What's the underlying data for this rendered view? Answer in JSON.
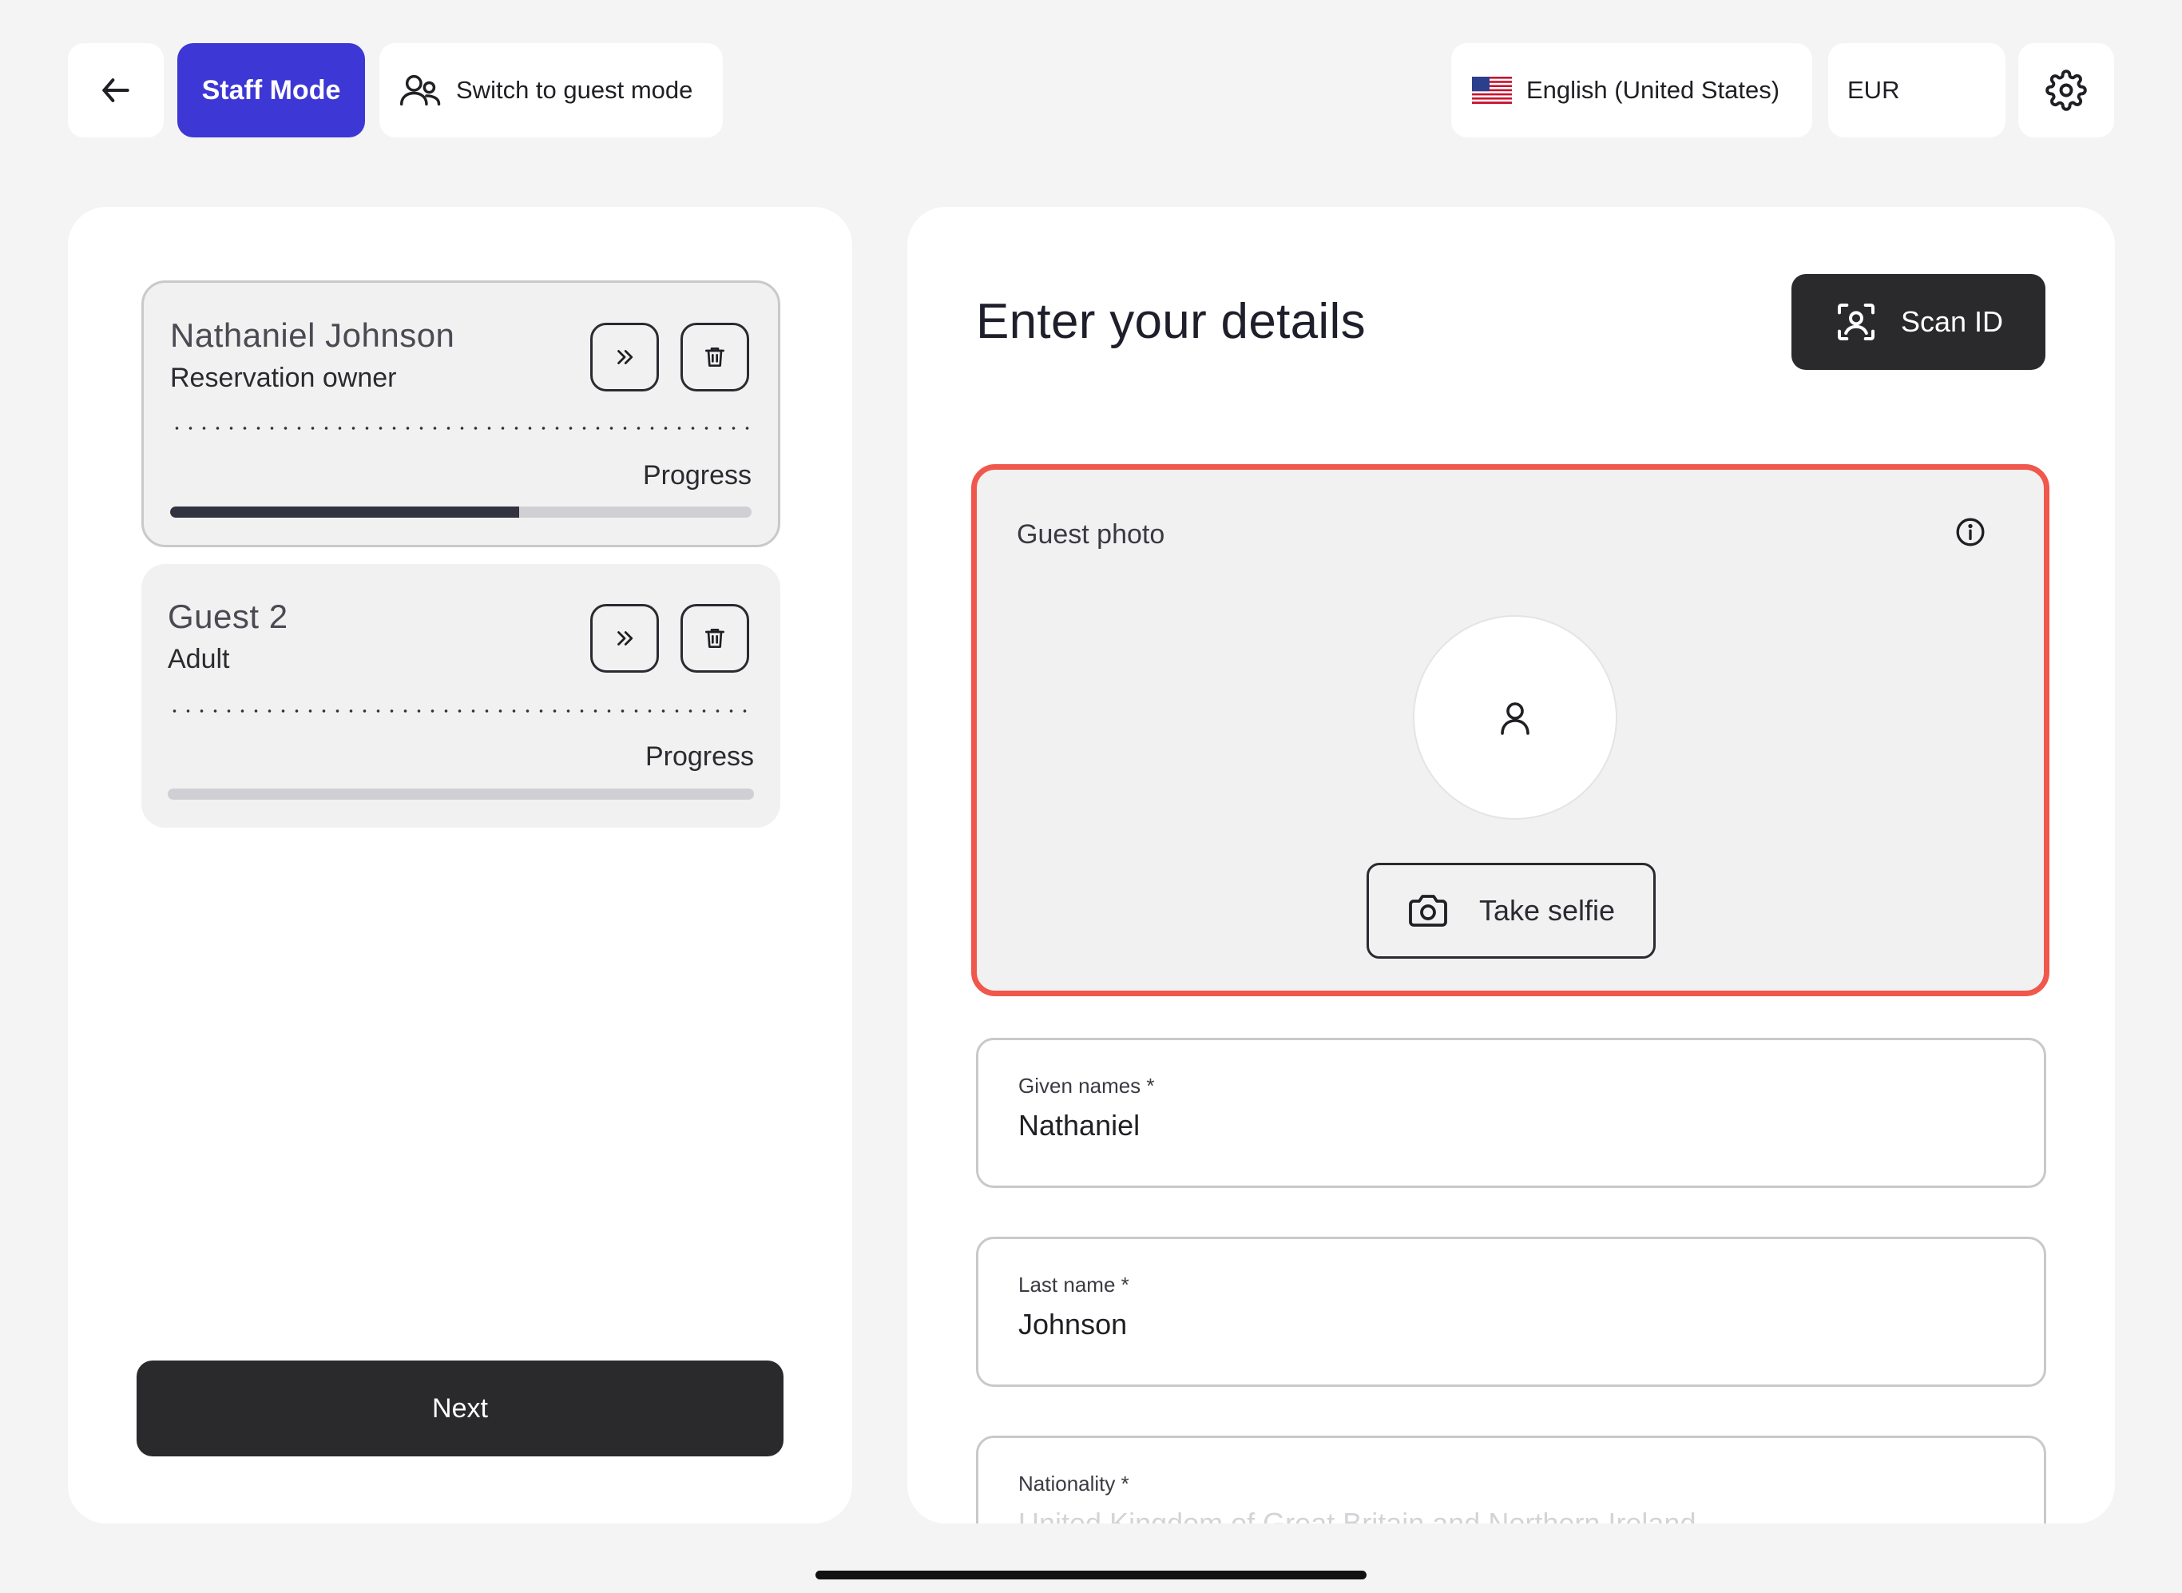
{
  "topbar": {
    "staff_mode_label": "Staff Mode",
    "switch_guest_label": "Switch to guest mode",
    "language_label": "English (United States)",
    "currency_label": "EUR"
  },
  "guests": [
    {
      "name": "Nathaniel Johnson",
      "role": "Reservation owner",
      "progress_label": "Progress",
      "progress": 0.6
    },
    {
      "name": "Guest 2",
      "role": "Adult",
      "progress_label": "Progress",
      "progress": 0
    }
  ],
  "next_label": "Next",
  "form": {
    "title": "Enter your details",
    "scan_label": "Scan ID",
    "photo_label": "Guest photo",
    "selfie_label": "Take selfie",
    "given_label": "Given names *",
    "given_value": "Nathaniel",
    "last_label": "Last name *",
    "last_value": "Johnson",
    "nationality_label": "Nationality *",
    "nationality_value": "United Kingdom of Great Britain and Northern Ireland"
  },
  "colors": {
    "accent": "#3d37d6",
    "highlight": "#f0574d",
    "dark_button": "#2a2a2c"
  },
  "icons": [
    "arrow-left-icon",
    "users-icon",
    "us-flag-icon",
    "gear-icon",
    "double-chevron-right-icon",
    "trash-icon",
    "scan-face-icon",
    "info-icon",
    "user-icon",
    "camera-icon"
  ]
}
